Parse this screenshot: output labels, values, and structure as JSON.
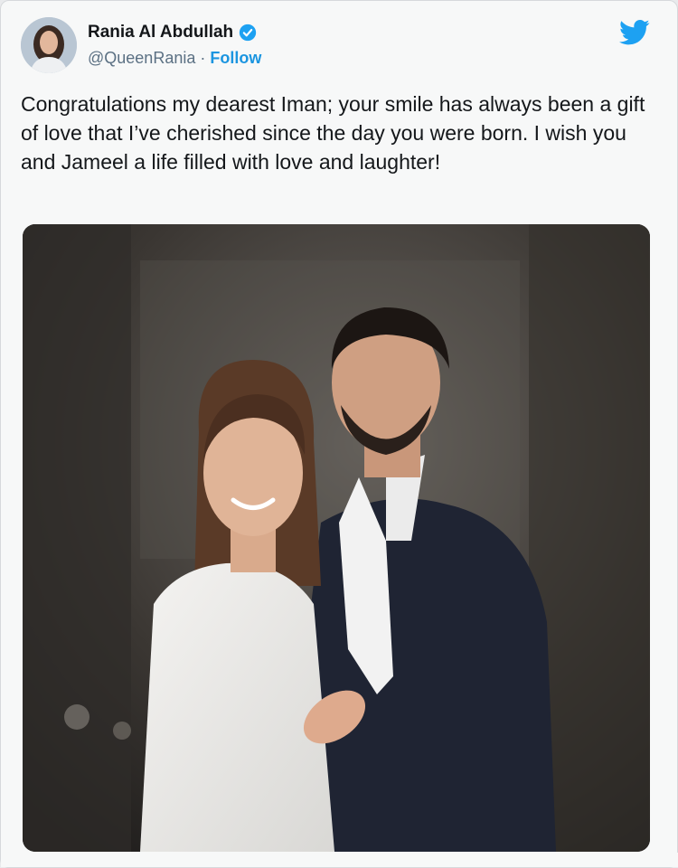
{
  "tweet": {
    "author_name": "Rania Al Abdullah",
    "handle": "@QueenRania",
    "separator": "·",
    "follow_label": "Follow",
    "text": "Congratulations my dearest Iman; your smile has always been a gift of love that I’ve cherished since the day you were born. I wish you and Jameel a life filled with love and laughter!"
  },
  "icons": {
    "verified": "verified-badge-icon",
    "logo": "twitter-bird-icon"
  },
  "colors": {
    "link_blue": "#1b95e0",
    "verified_blue": "#1da1f2",
    "text_dark": "#14171a",
    "text_muted": "#5b7083"
  }
}
